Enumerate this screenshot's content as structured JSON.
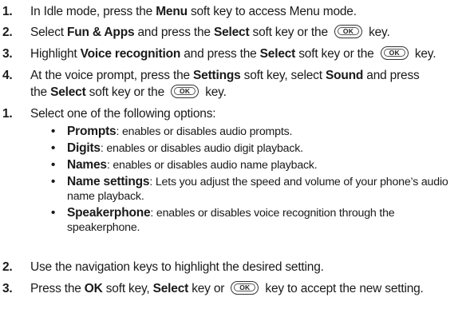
{
  "ok_key_label": "OK",
  "steps_a": [
    {
      "num": "1.",
      "p1": "In Idle mode, press the ",
      "b1": "Menu",
      "p2": " soft key to access Menu mode."
    },
    {
      "num": "2.",
      "p1": "Select ",
      "b1": "Fun & Apps",
      "p2": " and press the ",
      "b2": "Select",
      "p3": " soft key or the ",
      "p4": " key."
    },
    {
      "num": "3.",
      "p1": "Highlight ",
      "b1": "Voice recognition",
      "p2": " and press the ",
      "b2": "Select",
      "p3": " soft key or the ",
      "p4": " key."
    },
    {
      "num": "4.",
      "p1": "At the voice prompt, press the ",
      "b1": "Settings",
      "p2": " soft key, select ",
      "b2": "Sound",
      "p3": " and press",
      "l2a": "the ",
      "l2b": "Select",
      "l2c": " soft key or the ",
      "l2d": " key."
    }
  ],
  "step_b1": {
    "num": "1.",
    "text": "Select one of the following options:"
  },
  "options": [
    {
      "label": "Prompts",
      "text": ": enables or disables audio prompts."
    },
    {
      "label": "Digits",
      "text": ": enables or disables audio digit playback."
    },
    {
      "label": "Names",
      "text": ": enables or disables audio name playback."
    },
    {
      "label": "Name settings",
      "text": ": Lets you adjust the speed and volume of your phone’s audio",
      "text2": "name playback."
    },
    {
      "label": "Speakerphone",
      "text": ": enables or disables voice recognition through the",
      "text2": "speakerphone."
    }
  ],
  "step_b2": {
    "num": "2.",
    "text": "Use the navigation keys to highlight the desired setting."
  },
  "step_b3": {
    "num": "3.",
    "p1": "Press the ",
    "b1": "OK",
    "p2": " soft key, ",
    "b2": "Select",
    "p3": " key or ",
    "p4": " key to accept the new setting."
  }
}
